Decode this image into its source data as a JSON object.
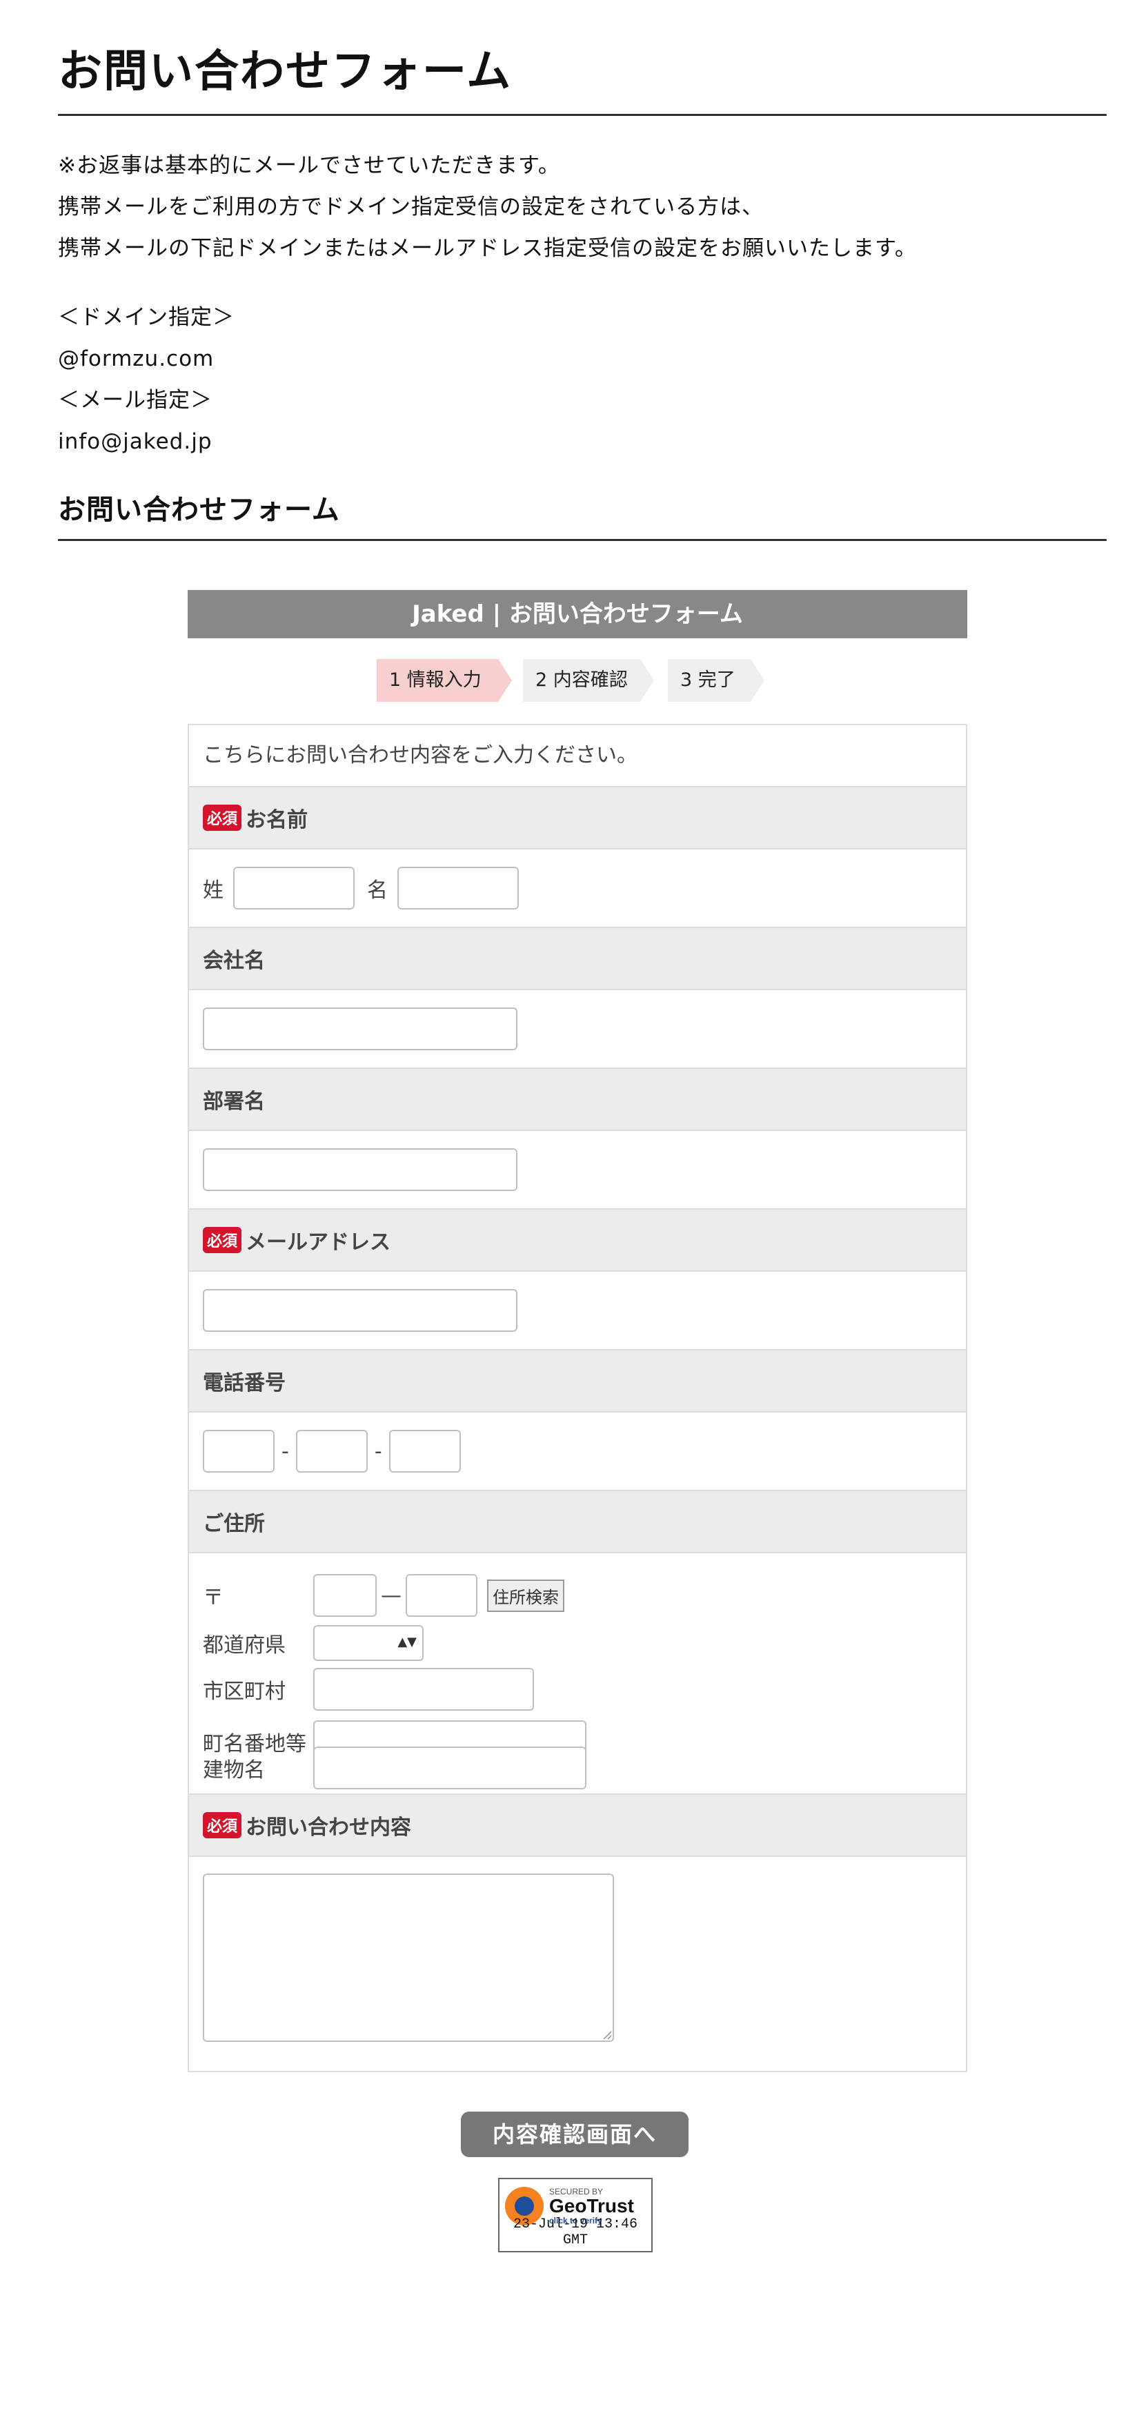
{
  "page": {
    "title": "お問い合わせフォーム",
    "intro_lines": [
      "※お返事は基本的にメールでさせていただきます。",
      "携帯メールをご利用の方でドメイン指定受信の設定をされている方は、",
      "携帯メールの下記ドメインまたはメールアドレス指定受信の設定をお願いいたします。"
    ],
    "domain_label": "＜ドメイン指定＞",
    "domain_value": "@formzu.com",
    "mail_label": "＜メール指定＞",
    "mail_value": "info@jaked.jp",
    "section_title": "お問い合わせフォーム"
  },
  "form": {
    "header": "Jaked | お問い合わせフォーム",
    "steps": [
      "1 情報入力",
      "2 内容確認",
      "3 完了"
    ],
    "note": "こちらにお問い合わせ内容をご入力ください。",
    "required_badge": "必須",
    "name_label": "お名前",
    "surname_label": "姓",
    "given_label": "名",
    "company_label": "会社名",
    "department_label": "部署名",
    "email_label": "メールアドレス",
    "phone_label": "電話番号",
    "phone_sep": "-",
    "address_label": "ご住所",
    "postal_mark": "〒",
    "postal_sep": "—",
    "address_search": "住所検索",
    "prefecture_label": "都道府県",
    "city_label": "市区町村",
    "street_label": "町名番地等",
    "building_label": "建物名",
    "inquiry_label": "お問い合わせ内容",
    "submit_label": "内容確認画面へ"
  },
  "badge": {
    "secured_by": "SECURED BY",
    "brand": "GeoTrust",
    "click": "click to verify",
    "date": "23-Jul-19 13:46 GMT"
  },
  "colors": {
    "header_bg": "#888888",
    "step_active": "#f7cfcf",
    "required": "#d4142d",
    "label_bg": "#ececec"
  }
}
